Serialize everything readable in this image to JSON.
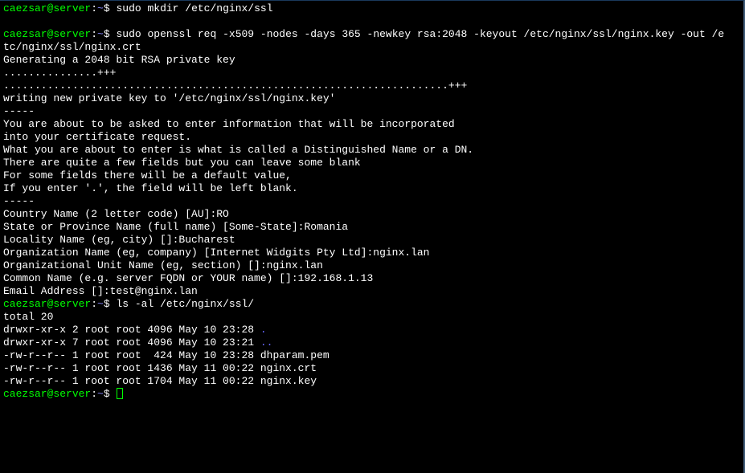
{
  "prompt": {
    "user_host": "caezsar@server",
    "path": "~",
    "symbol": "$"
  },
  "lines": {
    "cmd1": "sudo mkdir /etc/nginx/ssl",
    "cmd2": "sudo openssl req -x509 -nodes -days 365 -newkey rsa:2048 -keyout /etc/nginx/ssl/nginx.key -out /e",
    "cmd2b": "tc/nginx/ssl/nginx.crt",
    "out1": "Generating a 2048 bit RSA private key",
    "out2": "...............+++",
    "out3": ".......................................................................+++",
    "out4": "writing new private key to '/etc/nginx/ssl/nginx.key'",
    "out5": "-----",
    "out6": "You are about to be asked to enter information that will be incorporated",
    "out7": "into your certificate request.",
    "out8": "What you are about to enter is what is called a Distinguished Name or a DN.",
    "out9": "There are quite a few fields but you can leave some blank",
    "out10": "For some fields there will be a default value,",
    "out11": "If you enter '.', the field will be left blank.",
    "out12": "-----",
    "out13": "Country Name (2 letter code) [AU]:RO",
    "out14": "State or Province Name (full name) [Some-State]:Romania",
    "out15": "Locality Name (eg, city) []:Bucharest",
    "out16": "Organization Name (eg, company) [Internet Widgits Pty Ltd]:nginx.lan",
    "out17": "Organizational Unit Name (eg, section) []:nginx.lan",
    "out18": "Common Name (e.g. server FQDN or YOUR name) []:192.168.1.13",
    "out19": "Email Address []:test@nginx.lan",
    "cmd3": "ls -al /etc/nginx/ssl/",
    "ls1": "total 20",
    "ls2a": "drwxr-xr-x 2 root root 4096 May 10 23:28 ",
    "ls2b": ".",
    "ls3a": "drwxr-xr-x 7 root root 4096 May 10 23:21 ",
    "ls3b": "..",
    "ls4": "-rw-r--r-- 1 root root  424 May 10 23:28 dhparam.pem",
    "ls5": "-rw-r--r-- 1 root root 1436 May 11 00:22 nginx.crt",
    "ls6": "-rw-r--r-- 1 root root 1704 May 11 00:22 nginx.key"
  }
}
